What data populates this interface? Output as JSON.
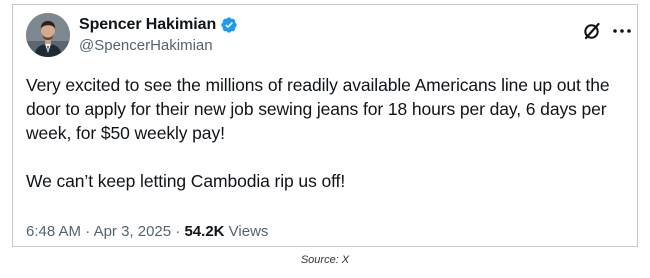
{
  "tweet": {
    "author": {
      "display_name": "Spencer Hakimian",
      "handle": "@SpencerHakimian",
      "verified": true,
      "avatar_icon": "profile-photo"
    },
    "text_paragraphs": [
      "Very excited to see the millions of readily available Americans line up out the door to apply for their new job sewing jeans for 18 hours per day, 6 days per week, for $50 weekly pay!",
      "We can’t keep letting Cambodia rip us off!"
    ],
    "time": "6:48 AM",
    "separator": "·",
    "date": "Apr 3, 2025",
    "views_count": "54.2K",
    "views_label": "Views",
    "icons": {
      "verified": "verified-badge-icon",
      "grok": "grok-icon",
      "more": "more-options-icon"
    },
    "colors": {
      "verified_blue": "#1d9bf0",
      "text": "#0f1419",
      "secondary": "#536471"
    }
  },
  "caption": {
    "source": "Source: X"
  }
}
